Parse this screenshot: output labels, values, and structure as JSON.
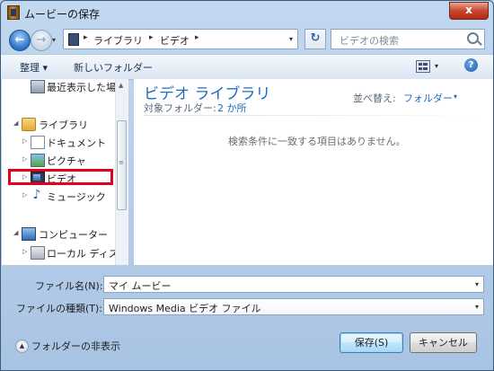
{
  "window": {
    "title": "ムービーの保存",
    "close_glyph": "x"
  },
  "nav": {
    "back_glyph": "←",
    "forward_glyph": "→",
    "drop_glyph": "▾"
  },
  "address": {
    "segments": [
      "ライブラリ",
      "ビデオ"
    ],
    "separator": "▸",
    "drop_glyph": "▾"
  },
  "refresh_glyph": "↻",
  "search": {
    "placeholder": "ビデオの検索"
  },
  "toolbar": {
    "organize": "整理 ▾",
    "new_folder": "新しいフォルダー",
    "view_drop": "▾",
    "help_glyph": "?"
  },
  "tree": {
    "recent": "最近表示した場所",
    "libraries": "ライブラリ",
    "documents": "ドキュメント",
    "pictures": "ピクチャ",
    "videos": "ビデオ",
    "music": "ミュージック",
    "computer": "コンピューター",
    "local_disk": "ローカル ディスク",
    "expand_glyph": "▷",
    "expanded_glyph": "◢",
    "music_glyph": "♪",
    "scroll_up": "▲",
    "scroll_grip": "≡"
  },
  "library": {
    "title": "ビデオ ライブラリ",
    "target_label": "対象フォルダー:",
    "target_value": "2 か所",
    "arrange_label": "並べ替え:",
    "arrange_value": "フォルダー",
    "arrange_drop": "▾",
    "empty_message": "検索条件に一致する項目はありません。"
  },
  "form": {
    "filename_label": "ファイル名(N):",
    "filename_value": "マイ ムービー",
    "filetype_label": "ファイルの種類(T):",
    "filetype_value": "Windows Media ビデオ ファイル",
    "drop_glyph": "▾"
  },
  "footer": {
    "hide_folders": "フォルダーの非表示",
    "hide_glyph": "▲",
    "save": "保存(S)",
    "cancel": "キャンセル"
  }
}
